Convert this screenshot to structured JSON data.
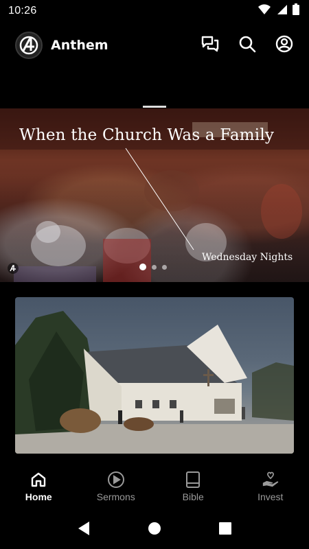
{
  "status_bar": {
    "time": "10:26",
    "icons": [
      "wifi-icon",
      "cellular-icon",
      "battery-icon"
    ]
  },
  "header": {
    "app_name": "Anthem",
    "actions": [
      "chat-icon",
      "search-icon",
      "account-icon"
    ]
  },
  "hero": {
    "title": "When the Church Was a Family",
    "subtitle": "Wednesday Nights",
    "slide_count": 3,
    "active_slide": 1
  },
  "bottom_nav": {
    "items": [
      {
        "label": "Home",
        "icon": "home-icon",
        "active": true
      },
      {
        "label": "Sermons",
        "icon": "play-circle-icon",
        "active": false
      },
      {
        "label": "Bible",
        "icon": "book-icon",
        "active": false
      },
      {
        "label": "Invest",
        "icon": "giving-hand-icon",
        "active": false
      }
    ]
  },
  "colors": {
    "background": "#000000",
    "active_nav": "#ffffff",
    "inactive_nav": "#9a9a9a"
  }
}
